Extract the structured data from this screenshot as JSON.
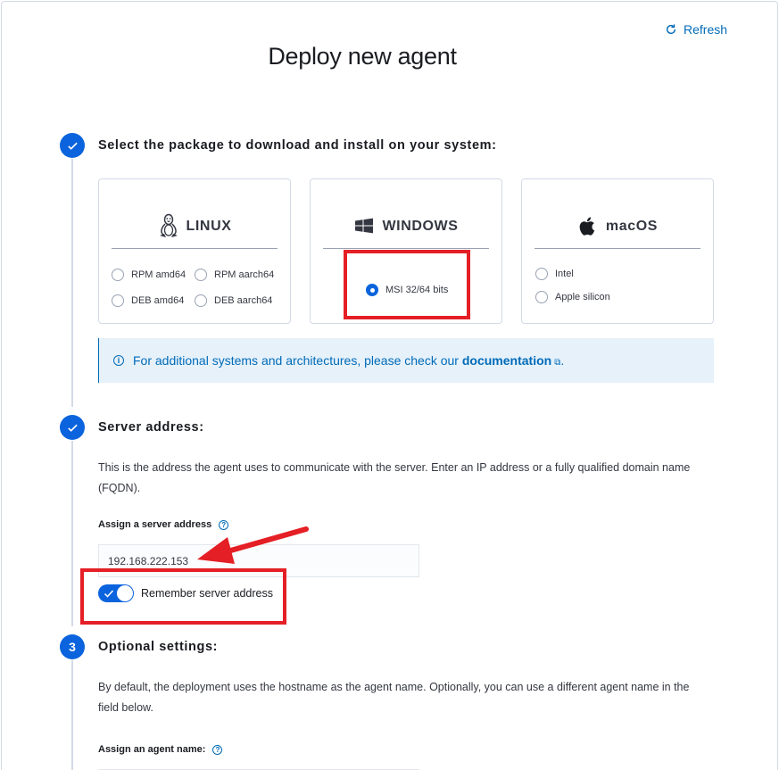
{
  "header": {
    "refresh_label": "Refresh",
    "title": "Deploy new agent"
  },
  "step1": {
    "title": "Select the package to download and install on your system:",
    "os_cards": [
      {
        "name": "LINUX",
        "icon": "linux-icon",
        "options": [
          "RPM amd64",
          "RPM aarch64",
          "DEB amd64",
          "DEB aarch64"
        ]
      },
      {
        "name": "WINDOWS",
        "icon": "windows-icon",
        "options": [
          "MSI 32/64 bits"
        ],
        "selected": "MSI 32/64 bits"
      },
      {
        "name": "macOS",
        "icon": "apple-icon",
        "options": [
          "Intel",
          "Apple silicon"
        ]
      }
    ],
    "callout_text": "For additional systems and architectures, please check our ",
    "callout_link": "documentation",
    "callout_end": "."
  },
  "step2": {
    "title": "Server address:",
    "description": "This is the address the agent uses to communicate with the server. Enter an IP address or a fully qualified domain name (FQDN).",
    "field_label": "Assign a server address",
    "value": "192.168.222.153",
    "toggle_label": "Remember server address",
    "toggle_on": true
  },
  "step3": {
    "number": "3",
    "title": "Optional settings:",
    "description": "By default, the deployment uses the hostname as the agent name. Optionally, you can use a different agent name in the field below.",
    "field_label": "Assign an agent name:"
  },
  "colors": {
    "accent": "#0b64dd",
    "link": "#006bb8",
    "annotation": "#e41f25",
    "callout_bg": "#e6f1fa"
  }
}
